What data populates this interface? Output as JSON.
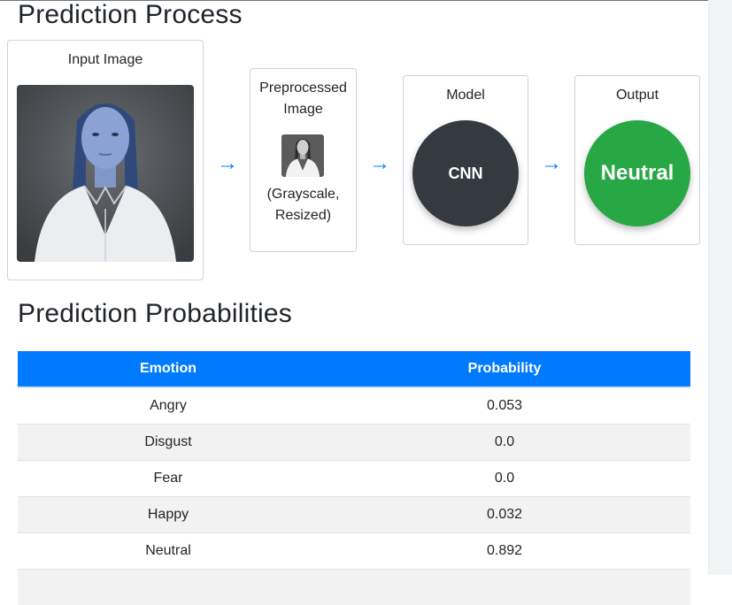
{
  "process": {
    "title": "Prediction Process",
    "input": {
      "label": "Input Image"
    },
    "preprocessed": {
      "label": "Preprocessed Image",
      "note": "(Grayscale, Resized)"
    },
    "model": {
      "label": "Model",
      "name": "CNN"
    },
    "output": {
      "label": "Output",
      "value": "Neutral"
    },
    "arrow_glyph": "→"
  },
  "probabilities": {
    "title": "Prediction Probabilities",
    "columns": [
      "Emotion",
      "Probability"
    ],
    "rows": [
      {
        "emotion": "Angry",
        "probability": "0.053"
      },
      {
        "emotion": "Disgust",
        "probability": "0.0"
      },
      {
        "emotion": "Fear",
        "probability": "0.0"
      },
      {
        "emotion": "Happy",
        "probability": "0.032"
      },
      {
        "emotion": "Neutral",
        "probability": "0.892"
      }
    ]
  },
  "colors": {
    "accent": "#007bff",
    "model_circle": "#343a40",
    "output_circle": "#28a745",
    "stripe_row": "#f2f2f2"
  }
}
